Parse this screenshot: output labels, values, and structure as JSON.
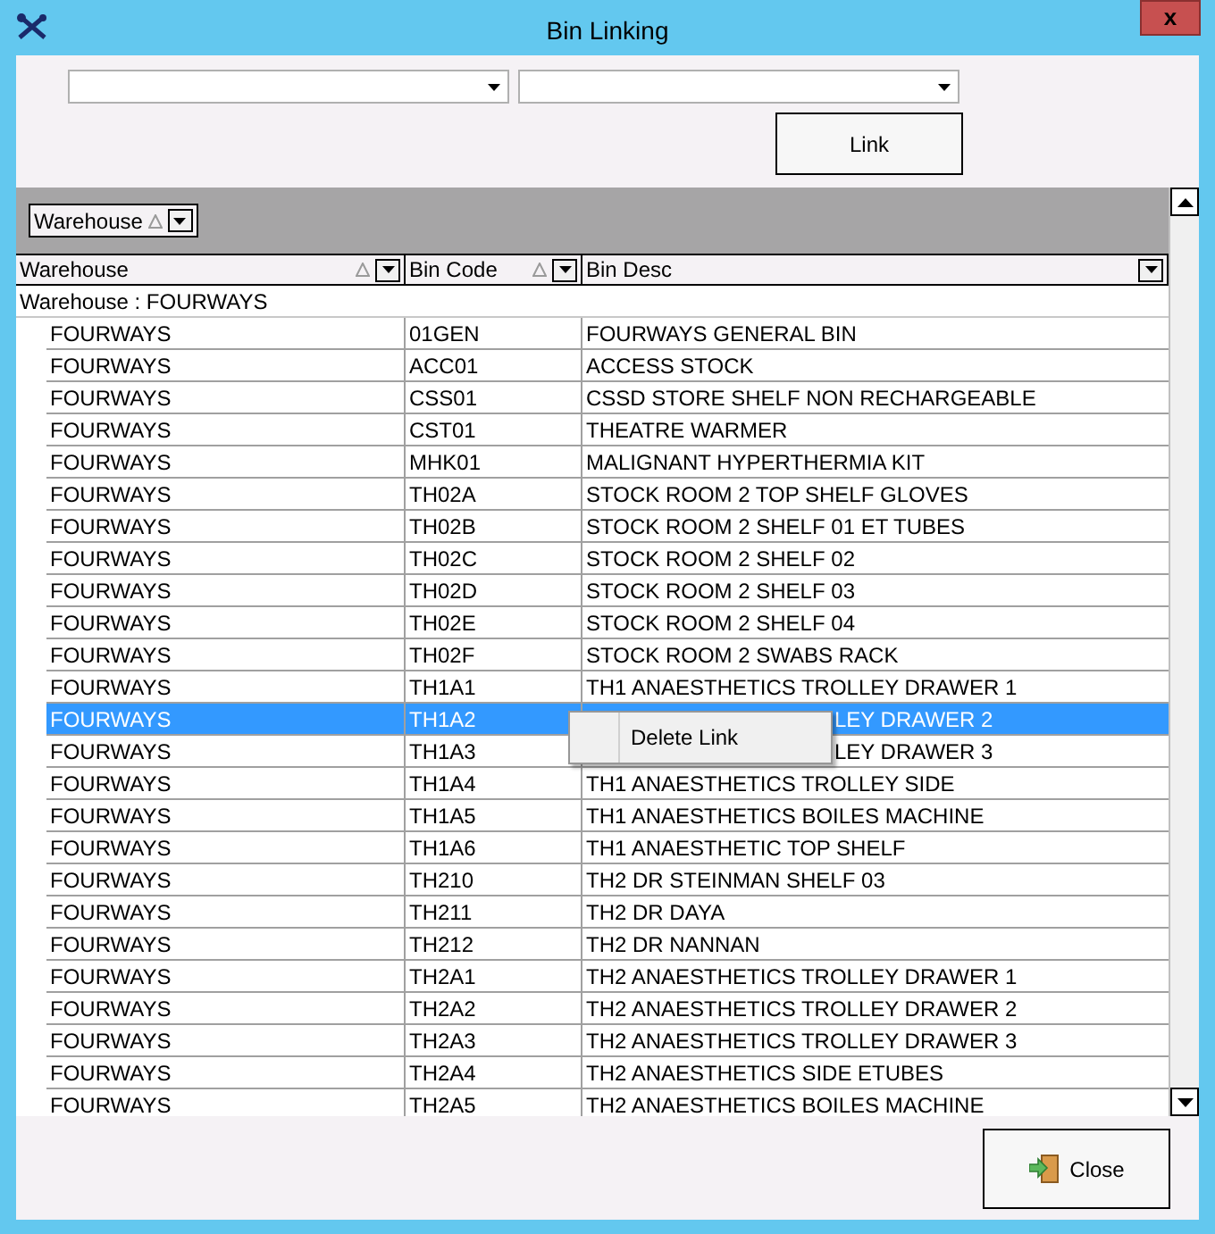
{
  "window": {
    "title": "Bin Linking",
    "close": "x"
  },
  "combos": [
    {
      "kind": "dropdown"
    },
    {
      "kind": "dropdown"
    }
  ],
  "link_button": "Link",
  "group_by": {
    "label": "Warehouse"
  },
  "table": {
    "columns": [
      {
        "label": "Warehouse",
        "sortable": true
      },
      {
        "label": "Bin Code",
        "sortable": true
      },
      {
        "label": "Bin Desc",
        "sortable": false
      }
    ],
    "group": "Warehouse : FOURWAYS",
    "rows": [
      {
        "warehouse": "FOURWAYS",
        "code": "01GEN",
        "desc": "FOURWAYS GENERAL BIN",
        "selected": false,
        "covered": false
      },
      {
        "warehouse": "FOURWAYS",
        "code": "ACC01",
        "desc": "ACCESS STOCK",
        "selected": false,
        "covered": false
      },
      {
        "warehouse": "FOURWAYS",
        "code": "CSS01",
        "desc": "CSSD STORE SHELF NON RECHARGEABLE",
        "selected": false,
        "covered": false
      },
      {
        "warehouse": "FOURWAYS",
        "code": "CST01",
        "desc": "THEATRE WARMER",
        "selected": false,
        "covered": false
      },
      {
        "warehouse": "FOURWAYS",
        "code": "MHK01",
        "desc": "MALIGNANT HYPERTHERMIA KIT",
        "selected": false,
        "covered": false
      },
      {
        "warehouse": "FOURWAYS",
        "code": "TH02A",
        "desc": "STOCK ROOM 2 TOP SHELF GLOVES",
        "selected": false,
        "covered": false
      },
      {
        "warehouse": "FOURWAYS",
        "code": "TH02B",
        "desc": "STOCK ROOM 2 SHELF 01 ET TUBES",
        "selected": false,
        "covered": false
      },
      {
        "warehouse": "FOURWAYS",
        "code": "TH02C",
        "desc": "STOCK ROOM 2 SHELF 02",
        "selected": false,
        "covered": false
      },
      {
        "warehouse": "FOURWAYS",
        "code": "TH02D",
        "desc": "STOCK ROOM 2 SHELF 03",
        "selected": false,
        "covered": false
      },
      {
        "warehouse": "FOURWAYS",
        "code": "TH02E",
        "desc": "STOCK ROOM 2 SHELF 04",
        "selected": false,
        "covered": false
      },
      {
        "warehouse": "FOURWAYS",
        "code": "TH02F",
        "desc": "STOCK ROOM 2 SWABS RACK",
        "selected": false,
        "covered": false
      },
      {
        "warehouse": "FOURWAYS",
        "code": "TH1A1",
        "desc": "TH1 ANAESTHETICS TROLLEY DRAWER 1",
        "selected": false,
        "covered": false
      },
      {
        "warehouse": "FOURWAYS",
        "code": "TH1A2",
        "desc": "LEY DRAWER 2",
        "selected": true,
        "covered": true
      },
      {
        "warehouse": "FOURWAYS",
        "code": "TH1A3",
        "desc": "LEY DRAWER 3",
        "selected": false,
        "covered": true
      },
      {
        "warehouse": "FOURWAYS",
        "code": "TH1A4",
        "desc": "TH1 ANAESTHETICS TROLLEY SIDE",
        "selected": false,
        "covered": false
      },
      {
        "warehouse": "FOURWAYS",
        "code": "TH1A5",
        "desc": "TH1 ANAESTHETICS BOILES MACHINE",
        "selected": false,
        "covered": false
      },
      {
        "warehouse": "FOURWAYS",
        "code": "TH1A6",
        "desc": "TH1 ANAESTHETIC TOP SHELF",
        "selected": false,
        "covered": false
      },
      {
        "warehouse": "FOURWAYS",
        "code": "TH210",
        "desc": "TH2 DR STEINMAN SHELF 03",
        "selected": false,
        "covered": false
      },
      {
        "warehouse": "FOURWAYS",
        "code": "TH211",
        "desc": "TH2 DR DAYA",
        "selected": false,
        "covered": false
      },
      {
        "warehouse": "FOURWAYS",
        "code": "TH212",
        "desc": "TH2 DR NANNAN",
        "selected": false,
        "covered": false
      },
      {
        "warehouse": "FOURWAYS",
        "code": "TH2A1",
        "desc": "TH2 ANAESTHETICS TROLLEY DRAWER 1",
        "selected": false,
        "covered": false
      },
      {
        "warehouse": "FOURWAYS",
        "code": "TH2A2",
        "desc": "TH2 ANAESTHETICS TROLLEY DRAWER 2",
        "selected": false,
        "covered": false
      },
      {
        "warehouse": "FOURWAYS",
        "code": "TH2A3",
        "desc": "TH2 ANAESTHETICS TROLLEY DRAWER 3",
        "selected": false,
        "covered": false
      },
      {
        "warehouse": "FOURWAYS",
        "code": "TH2A4",
        "desc": "TH2 ANAESTHETICS SIDE ETUBES",
        "selected": false,
        "covered": false
      },
      {
        "warehouse": "FOURWAYS",
        "code": "TH2A5",
        "desc": "TH2 ANAESTHETICS BOILES MACHINE",
        "selected": false,
        "covered": false
      }
    ]
  },
  "context_menu": {
    "items": [
      "Delete Link"
    ]
  },
  "close_button": "Close"
}
